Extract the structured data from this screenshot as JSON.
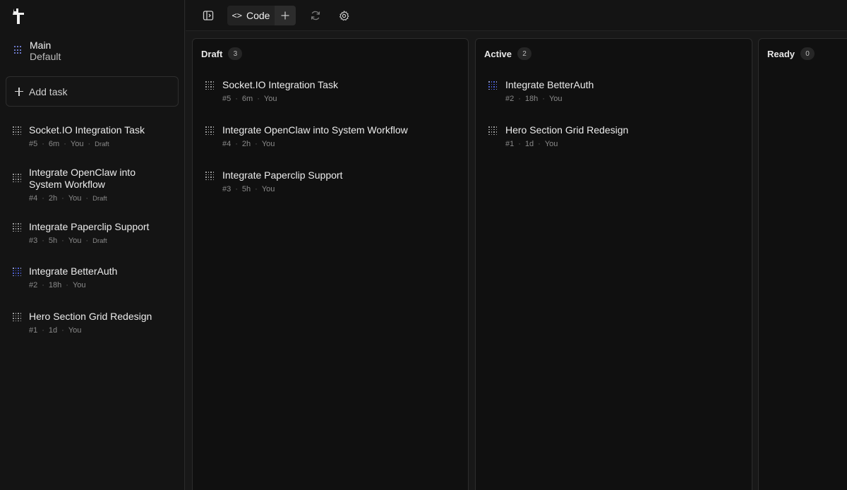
{
  "sidebar": {
    "workspace": {
      "name": "Main",
      "branch": "Default"
    },
    "add_task_label": "Add task",
    "tasks": [
      {
        "title": "Socket.IO Integration Task",
        "id": "#5",
        "age": "6m",
        "owner": "You",
        "status": "Draft",
        "icon": "grid-icon"
      },
      {
        "title": "Integrate OpenClaw into System Workflow",
        "id": "#4",
        "age": "2h",
        "owner": "You",
        "status": "Draft",
        "icon": "grid-icon"
      },
      {
        "title": "Integrate Paperclip Support",
        "id": "#3",
        "age": "5h",
        "owner": "You",
        "status": "Draft",
        "icon": "grid-icon"
      },
      {
        "title": "Integrate BetterAuth",
        "id": "#2",
        "age": "18h",
        "owner": "You",
        "status": "",
        "icon": "grid-blue-icon"
      },
      {
        "title": "Hero Section Grid Redesign",
        "id": "#1",
        "age": "1d",
        "owner": "You",
        "status": "",
        "icon": "grid-icon"
      }
    ]
  },
  "toolbar": {
    "code_tab_label": "Code",
    "icons": [
      "sidebar-toggle-icon",
      "code-icon",
      "plus-icon",
      "refresh-icon",
      "settings-icon"
    ]
  },
  "board": {
    "columns": [
      {
        "title": "Draft",
        "count": "3",
        "cards": [
          {
            "title": "Socket.IO Integration Task",
            "id": "#5",
            "age": "6m",
            "owner": "You"
          },
          {
            "title": "Integrate OpenClaw into System Workflow",
            "id": "#4",
            "age": "2h",
            "owner": "You"
          },
          {
            "title": "Integrate Paperclip Support",
            "id": "#3",
            "age": "5h",
            "owner": "You"
          }
        ]
      },
      {
        "title": "Active",
        "count": "2",
        "cards": [
          {
            "title": "Integrate BetterAuth",
            "id": "#2",
            "age": "18h",
            "owner": "You"
          },
          {
            "title": "Hero Section Grid Redesign",
            "id": "#1",
            "age": "1d",
            "owner": "You"
          }
        ]
      },
      {
        "title": "Ready",
        "count": "0",
        "cards": []
      }
    ]
  },
  "colors": {
    "background": "#181818",
    "panel": "#101010",
    "accent_blue": "#4a5fd8"
  }
}
